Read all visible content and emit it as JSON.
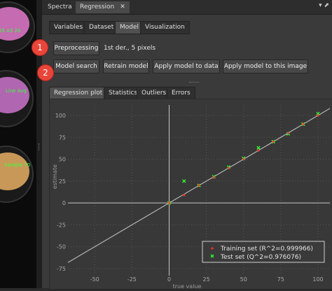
{
  "dock": {
    "tabs": [
      {
        "label": "Spectra"
      },
      {
        "label": "Regression"
      }
    ],
    "close_glyph": "✕",
    "controls": "▾ ⬈"
  },
  "left_panel": {
    "samples": [
      {
        "label": "65 A3 20"
      },
      {
        "label": "Line Avg"
      },
      {
        "label": "Sample 70"
      }
    ]
  },
  "main_tabs": [
    {
      "label": "Variables"
    },
    {
      "label": "Dataset"
    },
    {
      "label": "Model"
    },
    {
      "label": "Visualization"
    }
  ],
  "preprocessing": {
    "button": "Preprocessing",
    "value": "1st der., 5 pixels"
  },
  "actions": {
    "model_search": "Model search",
    "retrain": "Retrain model",
    "apply_data": "Apply model to data",
    "apply_image": "Apply model to this image"
  },
  "callouts": [
    "1",
    "2"
  ],
  "plot_tabs": [
    {
      "label": "Regression plot"
    },
    {
      "label": "Statistics"
    },
    {
      "label": "Outliers"
    },
    {
      "label": "Errors"
    }
  ],
  "colors": {
    "training": "#ff3030",
    "test": "#30ff30",
    "line": "#b4b4b4",
    "plot_bg": "#383838",
    "callout": "#e8463a"
  },
  "chart_data": {
    "type": "scatter",
    "xlabel": "true value",
    "ylabel": "estimate",
    "xlim": [
      -68,
      108
    ],
    "ylim": [
      -83,
      112
    ],
    "x_ticks": [
      -50,
      -25,
      0,
      25,
      50,
      75,
      100
    ],
    "y_ticks": [
      -75,
      -50,
      -25,
      0,
      25,
      50,
      75,
      100
    ],
    "grid": true,
    "legend_position": "bottom-right",
    "identity_line": true,
    "series": [
      {
        "name": "Training set (R^2=0.999966)",
        "marker": "+",
        "points": [
          [
            0,
            0
          ],
          [
            10,
            9
          ],
          [
            20,
            20
          ],
          [
            30,
            29
          ],
          [
            40,
            40
          ],
          [
            50,
            50
          ],
          [
            60,
            60
          ],
          [
            70,
            70
          ],
          [
            80,
            80
          ],
          [
            90,
            90
          ],
          [
            100,
            100
          ]
        ]
      },
      {
        "name": "Test set (Q^2=0.976076)",
        "marker": "x",
        "points": [
          [
            0,
            0
          ],
          [
            10,
            25
          ],
          [
            20,
            20
          ],
          [
            30,
            30
          ],
          [
            40,
            41
          ],
          [
            50,
            51
          ],
          [
            60,
            63
          ],
          [
            70,
            70
          ],
          [
            80,
            79
          ],
          [
            90,
            90
          ],
          [
            100,
            102
          ]
        ]
      }
    ]
  }
}
